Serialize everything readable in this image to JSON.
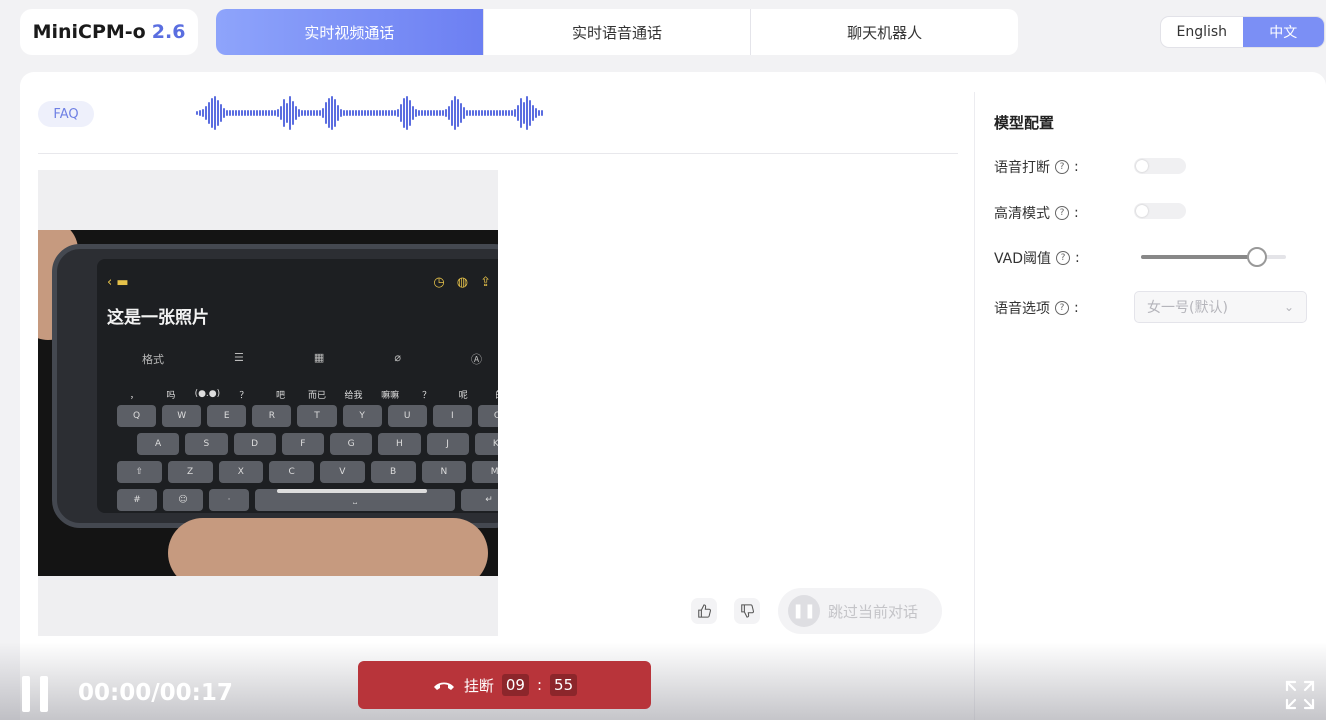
{
  "app": {
    "name": "MiniCPM-o",
    "version": "2.6"
  },
  "tabs": [
    {
      "label": "实时视频通话",
      "active": true
    },
    {
      "label": "实时语音通话",
      "active": false
    },
    {
      "label": "聊天机器人",
      "active": false
    }
  ],
  "lang": {
    "en": "English",
    "zh": "中文",
    "selected": "中文"
  },
  "faq": {
    "label": "FAQ"
  },
  "video": {
    "phone_title": "这是一张照片",
    "toolbar": [
      "格式",
      "☰",
      "▦",
      "⌀",
      "Ⓐ"
    ],
    "suggestions": [
      "，",
      "吗",
      "(●.●)",
      "？",
      "吧",
      "而已",
      "给我",
      "嘛嘛",
      "？",
      "呢",
      "的"
    ],
    "keys_row1": [
      "Q",
      "W",
      "E",
      "R",
      "T",
      "Y",
      "U",
      "I",
      "O"
    ],
    "keys_row2": [
      "A",
      "S",
      "D",
      "F",
      "G",
      "H",
      "J",
      "K"
    ],
    "keys_row3": [
      "⇧",
      "Z",
      "X",
      "C",
      "V",
      "B",
      "N",
      "M"
    ]
  },
  "feedback": {
    "like_icon": "thumbs-up-icon",
    "dislike_icon": "thumbs-down-icon"
  },
  "skip": {
    "label": "跳过当前对话"
  },
  "config": {
    "title": "模型配置",
    "voice_interrupt": {
      "label": "语音打断",
      "enabled": false
    },
    "hd_mode": {
      "label": "高清模式",
      "enabled": false
    },
    "vad": {
      "label": "VAD阈值",
      "value": 0.8
    },
    "voice_option": {
      "label": "语音选项",
      "value": "女一号(默认)"
    }
  },
  "player": {
    "time": "00:00/00:17"
  },
  "call": {
    "hangup_label": "挂断",
    "minutes": "09",
    "seconds": "55"
  },
  "colors": {
    "accent": "#6c7ff2",
    "hangup": "#b8343a",
    "wave": "#5b6de0"
  }
}
